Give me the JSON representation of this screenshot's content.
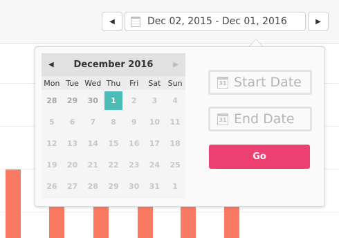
{
  "toolbar": {
    "prev_icon": "triangle-left-icon",
    "next_icon": "triangle-right-icon",
    "range_label": "Dec 02, 2015 - Dec 01, 2016"
  },
  "calendar": {
    "title": "December 2016",
    "weekdays": [
      "Mon",
      "Tue",
      "Wed",
      "Thu",
      "Fri",
      "Sat",
      "Sun"
    ],
    "weeks": [
      [
        "28",
        "29",
        "30",
        "1",
        "2",
        "3",
        "4"
      ],
      [
        "5",
        "6",
        "7",
        "8",
        "9",
        "10",
        "11"
      ],
      [
        "12",
        "13",
        "14",
        "15",
        "16",
        "17",
        "18"
      ],
      [
        "19",
        "20",
        "21",
        "22",
        "23",
        "24",
        "25"
      ],
      [
        "26",
        "27",
        "28",
        "29",
        "30",
        "31",
        "1"
      ]
    ],
    "selected_color": "#4cbcb6"
  },
  "form": {
    "start_label": "Start Date",
    "end_label": "End Date",
    "icon_day": "31",
    "go_label": "Go",
    "go_color": "#ec4170"
  },
  "chart": {
    "bar_color": "#fa7a64"
  }
}
